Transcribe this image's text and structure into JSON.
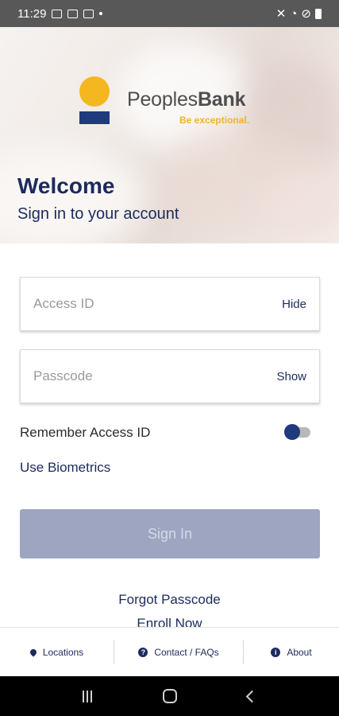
{
  "status_bar": {
    "time": "11:29"
  },
  "brand": {
    "name_part1": "Peoples",
    "name_part2": "Bank",
    "tagline": "Be exceptional.",
    "colors": {
      "navy": "#1c2a5e",
      "gold": "#f4b71f"
    }
  },
  "hero": {
    "title": "Welcome",
    "subtitle": "Sign in to your account"
  },
  "form": {
    "access_id": {
      "placeholder": "Access ID",
      "value": "",
      "toggle_label": "Hide"
    },
    "passcode": {
      "placeholder": "Passcode",
      "value": "",
      "toggle_label": "Show"
    },
    "remember_label": "Remember Access ID",
    "remember_on": false,
    "biometrics_label": "Use Biometrics",
    "sign_in_label": "Sign In"
  },
  "links": {
    "forgot": "Forgot Passcode",
    "enroll": "Enroll Now"
  },
  "footer": [
    {
      "icon": "location-pin-icon",
      "label": "Locations"
    },
    {
      "icon": "help-circle-icon",
      "label": "Contact / FAQs"
    },
    {
      "icon": "info-circle-icon",
      "label": "About"
    }
  ]
}
